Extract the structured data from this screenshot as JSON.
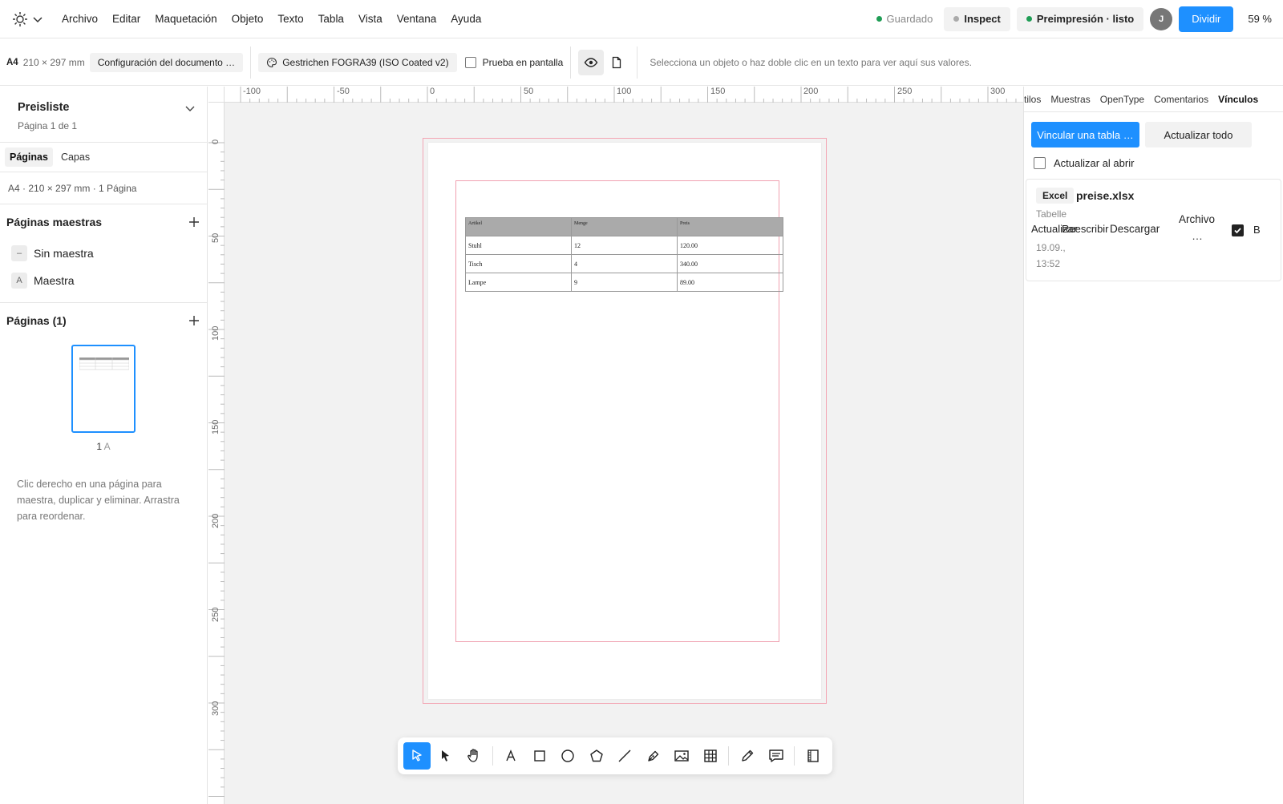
{
  "menubar": {
    "logo_icon": "cog-logo-icon",
    "items": [
      "Archivo",
      "Editar",
      "Maquetación",
      "Objeto",
      "Texto",
      "Tabla",
      "Vista",
      "Ventana",
      "Ayuda"
    ],
    "saved_label": "Guardado",
    "inspect_label": "Inspect",
    "preflight_label": "Preimpresión · listo",
    "avatar_initial": "J",
    "split_label": "Dividir",
    "zoom_label": "59 %",
    "colors": {
      "saved_dot": "#1f9d55",
      "preflight_dot": "#1f9d55",
      "inspect_dot": "#aaaaaa",
      "accent": "#1e90ff"
    }
  },
  "toolbar": {
    "format": "A4",
    "size": "210 × 297 mm",
    "doc_setup_label": "Configuración del documento …",
    "color_profile_label": "Gestrichen FOGRA39 (ISO Coated v2)",
    "soft_proof_label": "Prueba en pantalla",
    "hint": "Selecciona un objeto o haz doble clic en un texto para ver aquí sus valores."
  },
  "left_panel": {
    "doc_title": "Preisliste",
    "doc_sub": "Página 1 de 1",
    "tabs": [
      "Páginas",
      "Capas"
    ],
    "info": "A4 · 210 × 297 mm · 1 Página",
    "masters_heading": "Páginas maestras",
    "masters": [
      {
        "badge": "–",
        "label": "Sin maestra"
      },
      {
        "badge": "A",
        "label": "Maestra"
      }
    ],
    "pages_heading": "Páginas (1)",
    "thumb_number": "1",
    "thumb_master": "A",
    "help": "Clic derecho en una página para maestra, duplicar y eliminar. Arrastra para reordenar."
  },
  "canvas": {
    "ruler_h": [
      "-100",
      "-50",
      "0",
      "50",
      "100",
      "150",
      "200",
      "250",
      "300"
    ],
    "ruler_v": [
      "0",
      "50",
      "100",
      "150",
      "200",
      "250",
      "300"
    ],
    "table": {
      "headers": [
        "Artikel",
        "Menge",
        "Preis"
      ],
      "rows": [
        [
          "Stuhl",
          "12",
          "120.00"
        ],
        [
          "Tisch",
          "4",
          "340.00"
        ],
        [
          "Lampe",
          "9",
          "89.00"
        ]
      ]
    }
  },
  "tools": [
    "select-icon",
    "direct-select-icon",
    "hand-icon",
    "text-icon",
    "rectangle-icon",
    "ellipse-icon",
    "polygon-icon",
    "line-icon",
    "pen-icon",
    "image-icon",
    "table-icon",
    "pencil-icon",
    "comment-icon",
    "frame-icon"
  ],
  "right_panel": {
    "tabs": [
      "tilos",
      "Muestras",
      "OpenType",
      "Comentarios",
      "Vínculos"
    ],
    "link_table_label": "Vincular una tabla …",
    "update_all_label": "Actualizar todo",
    "update_on_open_label": "Actualizar al abrir",
    "link": {
      "badge": "Excel",
      "file": "preise.xlsx",
      "kind": "Tabelle",
      "date_line1": "19.09.,",
      "date_line2": "13:52",
      "action_update": "Actualizar",
      "action_rewrite": "Reescribir",
      "action_download": "Descargar",
      "action_file": "Archivo",
      "more": "…",
      "trailing": "B"
    }
  }
}
